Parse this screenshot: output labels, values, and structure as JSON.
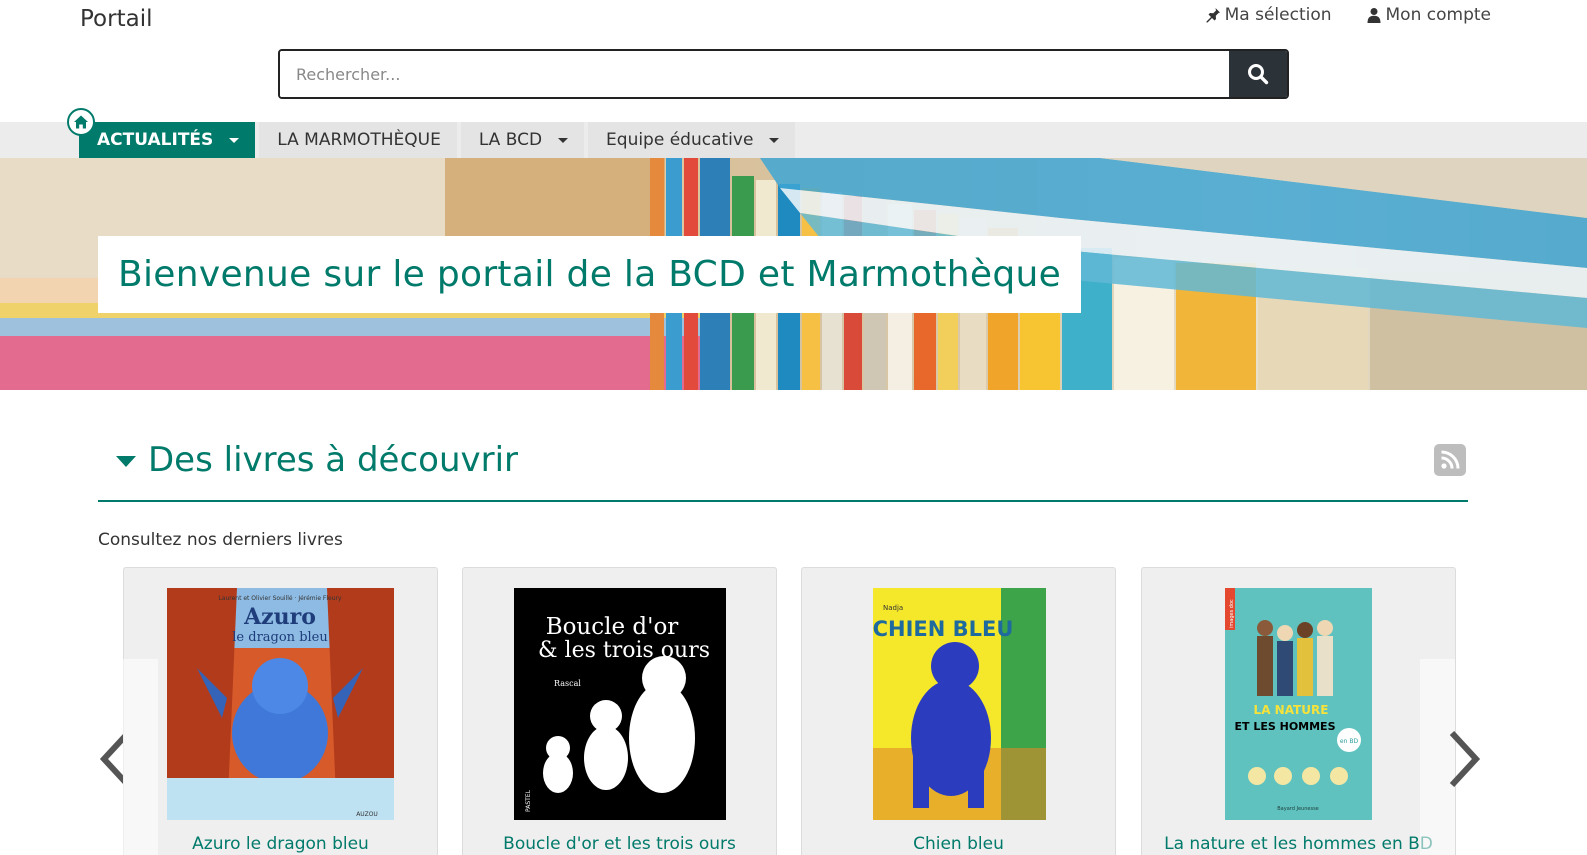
{
  "header": {
    "site_title": "Portail",
    "links": [
      {
        "label": "Ma sélection",
        "icon": "pin-icon"
      },
      {
        "label": "Mon compte",
        "icon": "user-icon"
      }
    ],
    "search": {
      "placeholder": "Rechercher...",
      "value": ""
    }
  },
  "nav": {
    "home_icon": "home-icon",
    "items": [
      {
        "label": "ACTUALITÉS",
        "active": true,
        "dropdown": true
      },
      {
        "label": "LA MARMOTHÈQUE",
        "active": false,
        "dropdown": false
      },
      {
        "label": "LA BCD",
        "active": false,
        "dropdown": true
      },
      {
        "label": "Equipe éducative",
        "active": false,
        "dropdown": true
      }
    ]
  },
  "hero": {
    "title": "Bienvenue sur le portail de la BCD et Marmothèque"
  },
  "section": {
    "title": "Des livres à découvrir",
    "subtitle": "Consultez nos derniers livres",
    "rss_icon": "rss-icon"
  },
  "books": [
    {
      "title": "Azuro le dragon bleu",
      "cover_title": "Azuro",
      "cover_subtitle": "le dragon bleu",
      "cover_authors": "Laurent et Olivier Souillé · Jérémie Fleury",
      "cover_publisher": "AUZOU"
    },
    {
      "title": "Boucle d'or et les trois ours",
      "cover_title": "Boucle d'or",
      "cover_subtitle": "& les trois ours",
      "cover_authors": "Rascal",
      "cover_publisher": "PASTEL"
    },
    {
      "title": "Chien bleu",
      "cover_title": "CHIEN BLEU",
      "cover_authors": "Nadja"
    },
    {
      "title": "La nature et les hommes en BD",
      "cover_title": "LA NATURE",
      "cover_subtitle": "ET LES HOMMES",
      "cover_badge": "en BD",
      "cover_publisher": "Bayard Jeunesse",
      "cover_series": "images doc"
    }
  ],
  "colors": {
    "brand": "#007a6a",
    "search_button": "#2b3238",
    "nav_bg": "#ececec"
  }
}
